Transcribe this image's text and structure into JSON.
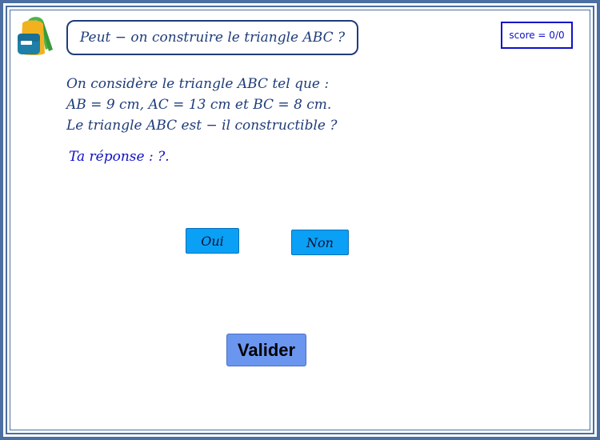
{
  "header": {
    "title": "Peut − on construire le triangle ABC ?",
    "score": "score = 0/0"
  },
  "question": {
    "line1": "On considère le triangle ABC tel que :",
    "line2": "AB = 9 cm, AC = 13 cm et BC = 8 cm.",
    "line3": "Le triangle ABC est − il constructible ?"
  },
  "answer": {
    "text": "Ta réponse : ?."
  },
  "choices": {
    "yes": "Oui",
    "no": "Non"
  },
  "actions": {
    "validate": "Valider"
  },
  "icons": {
    "logo": "backpack-icon"
  },
  "colors": {
    "frame": "#4a6fa0",
    "title_text": "#1f3c7a",
    "score_text": "#1010c8",
    "choice_button": "#0aa0f5",
    "validate_button": "#6b96f0"
  }
}
